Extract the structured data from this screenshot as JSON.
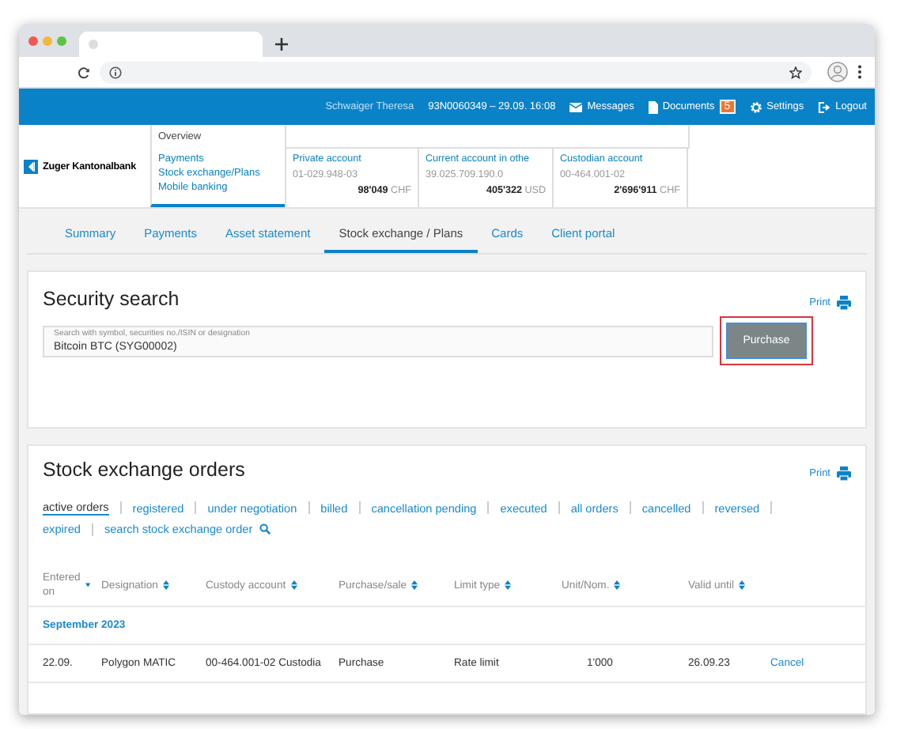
{
  "header": {
    "user": "Schwaiger Theresa",
    "session": "93N0060349 – 29.09. 16:08",
    "links": [
      {
        "kind": "messages",
        "label": "Messages"
      },
      {
        "kind": "documents",
        "label": "Documents",
        "badge": "5"
      },
      {
        "kind": "settings",
        "label": "Settings"
      },
      {
        "kind": "logout",
        "label": "Logout"
      }
    ]
  },
  "logo": {
    "name": "Zuger Kantonalbank"
  },
  "menu": [
    {
      "label": "Overview",
      "selected": true
    },
    {
      "label": "Payments",
      "selected": false
    },
    {
      "label": "Stock exchange/Plans",
      "selected": false
    },
    {
      "label": "Mobile banking",
      "selected": false
    }
  ],
  "accounts": [
    {
      "name": "Private account",
      "number": "01-029.948-03",
      "amount": "98'049",
      "currency": "CHF"
    },
    {
      "name": "Current account in othe",
      "number": "39.025.709.190.0",
      "amount": "405'322",
      "currency": "USD"
    },
    {
      "name": "Custodian account",
      "number": "00-464.001-02",
      "amount": "2'696'911",
      "currency": "CHF"
    }
  ],
  "tabs": [
    {
      "label": "Summary",
      "selected": false
    },
    {
      "label": "Payments",
      "selected": false
    },
    {
      "label": "Asset statement",
      "selected": false
    },
    {
      "label": "Stock exchange / Plans",
      "selected": true
    },
    {
      "label": "Cards",
      "selected": false
    },
    {
      "label": "Client portal",
      "selected": false
    }
  ],
  "security_search": {
    "title": "Security search",
    "print": "Print",
    "field": {
      "label": "Search with symbol, securities no./ISIN or designation",
      "value": "Bitcoin BTC (SYG00002)"
    },
    "button": {
      "label": "Purchase",
      "highlighted": true
    }
  },
  "orders": {
    "title": "Stock exchange orders",
    "print": "Print",
    "filters": [
      {
        "label": "active orders",
        "selected": true,
        "kind": "filter"
      },
      {
        "label": "registered",
        "selected": false,
        "kind": "filter"
      },
      {
        "label": "under negotiation",
        "selected": false,
        "kind": "filter"
      },
      {
        "label": "billed",
        "selected": false,
        "kind": "filter"
      },
      {
        "label": "cancellation pending",
        "selected": false,
        "kind": "filter"
      },
      {
        "label": "executed",
        "selected": false,
        "kind": "filter"
      },
      {
        "label": "all orders",
        "selected": false,
        "kind": "filter"
      },
      {
        "label": "cancelled",
        "selected": false,
        "kind": "filter"
      },
      {
        "label": "reversed",
        "selected": false,
        "kind": "filter"
      },
      {
        "label": "expired",
        "selected": false,
        "kind": "filter"
      }
    ],
    "search_link": "search stock exchange order",
    "table": {
      "columns": [
        {
          "label": "Entered on",
          "sorted": true
        },
        {
          "label": "Designation",
          "sorted": false
        },
        {
          "label": "Custody account",
          "sorted": false
        },
        {
          "label": "Purchase/sale",
          "sorted": false
        },
        {
          "label": "Limit type",
          "sorted": false
        },
        {
          "label": "Unit/Nom.",
          "sorted": false
        },
        {
          "label": "Valid until",
          "sorted": false
        }
      ],
      "groups": [
        {
          "title": "September 2023",
          "rows": [
            {
              "cells": [
                "22.09.",
                "Polygon MATIC",
                "00-464.001-02 Custodia",
                "Purchase",
                "Rate limit",
                "1'000",
                "26.09.23"
              ],
              "action": "Cancel"
            }
          ]
        }
      ]
    }
  }
}
